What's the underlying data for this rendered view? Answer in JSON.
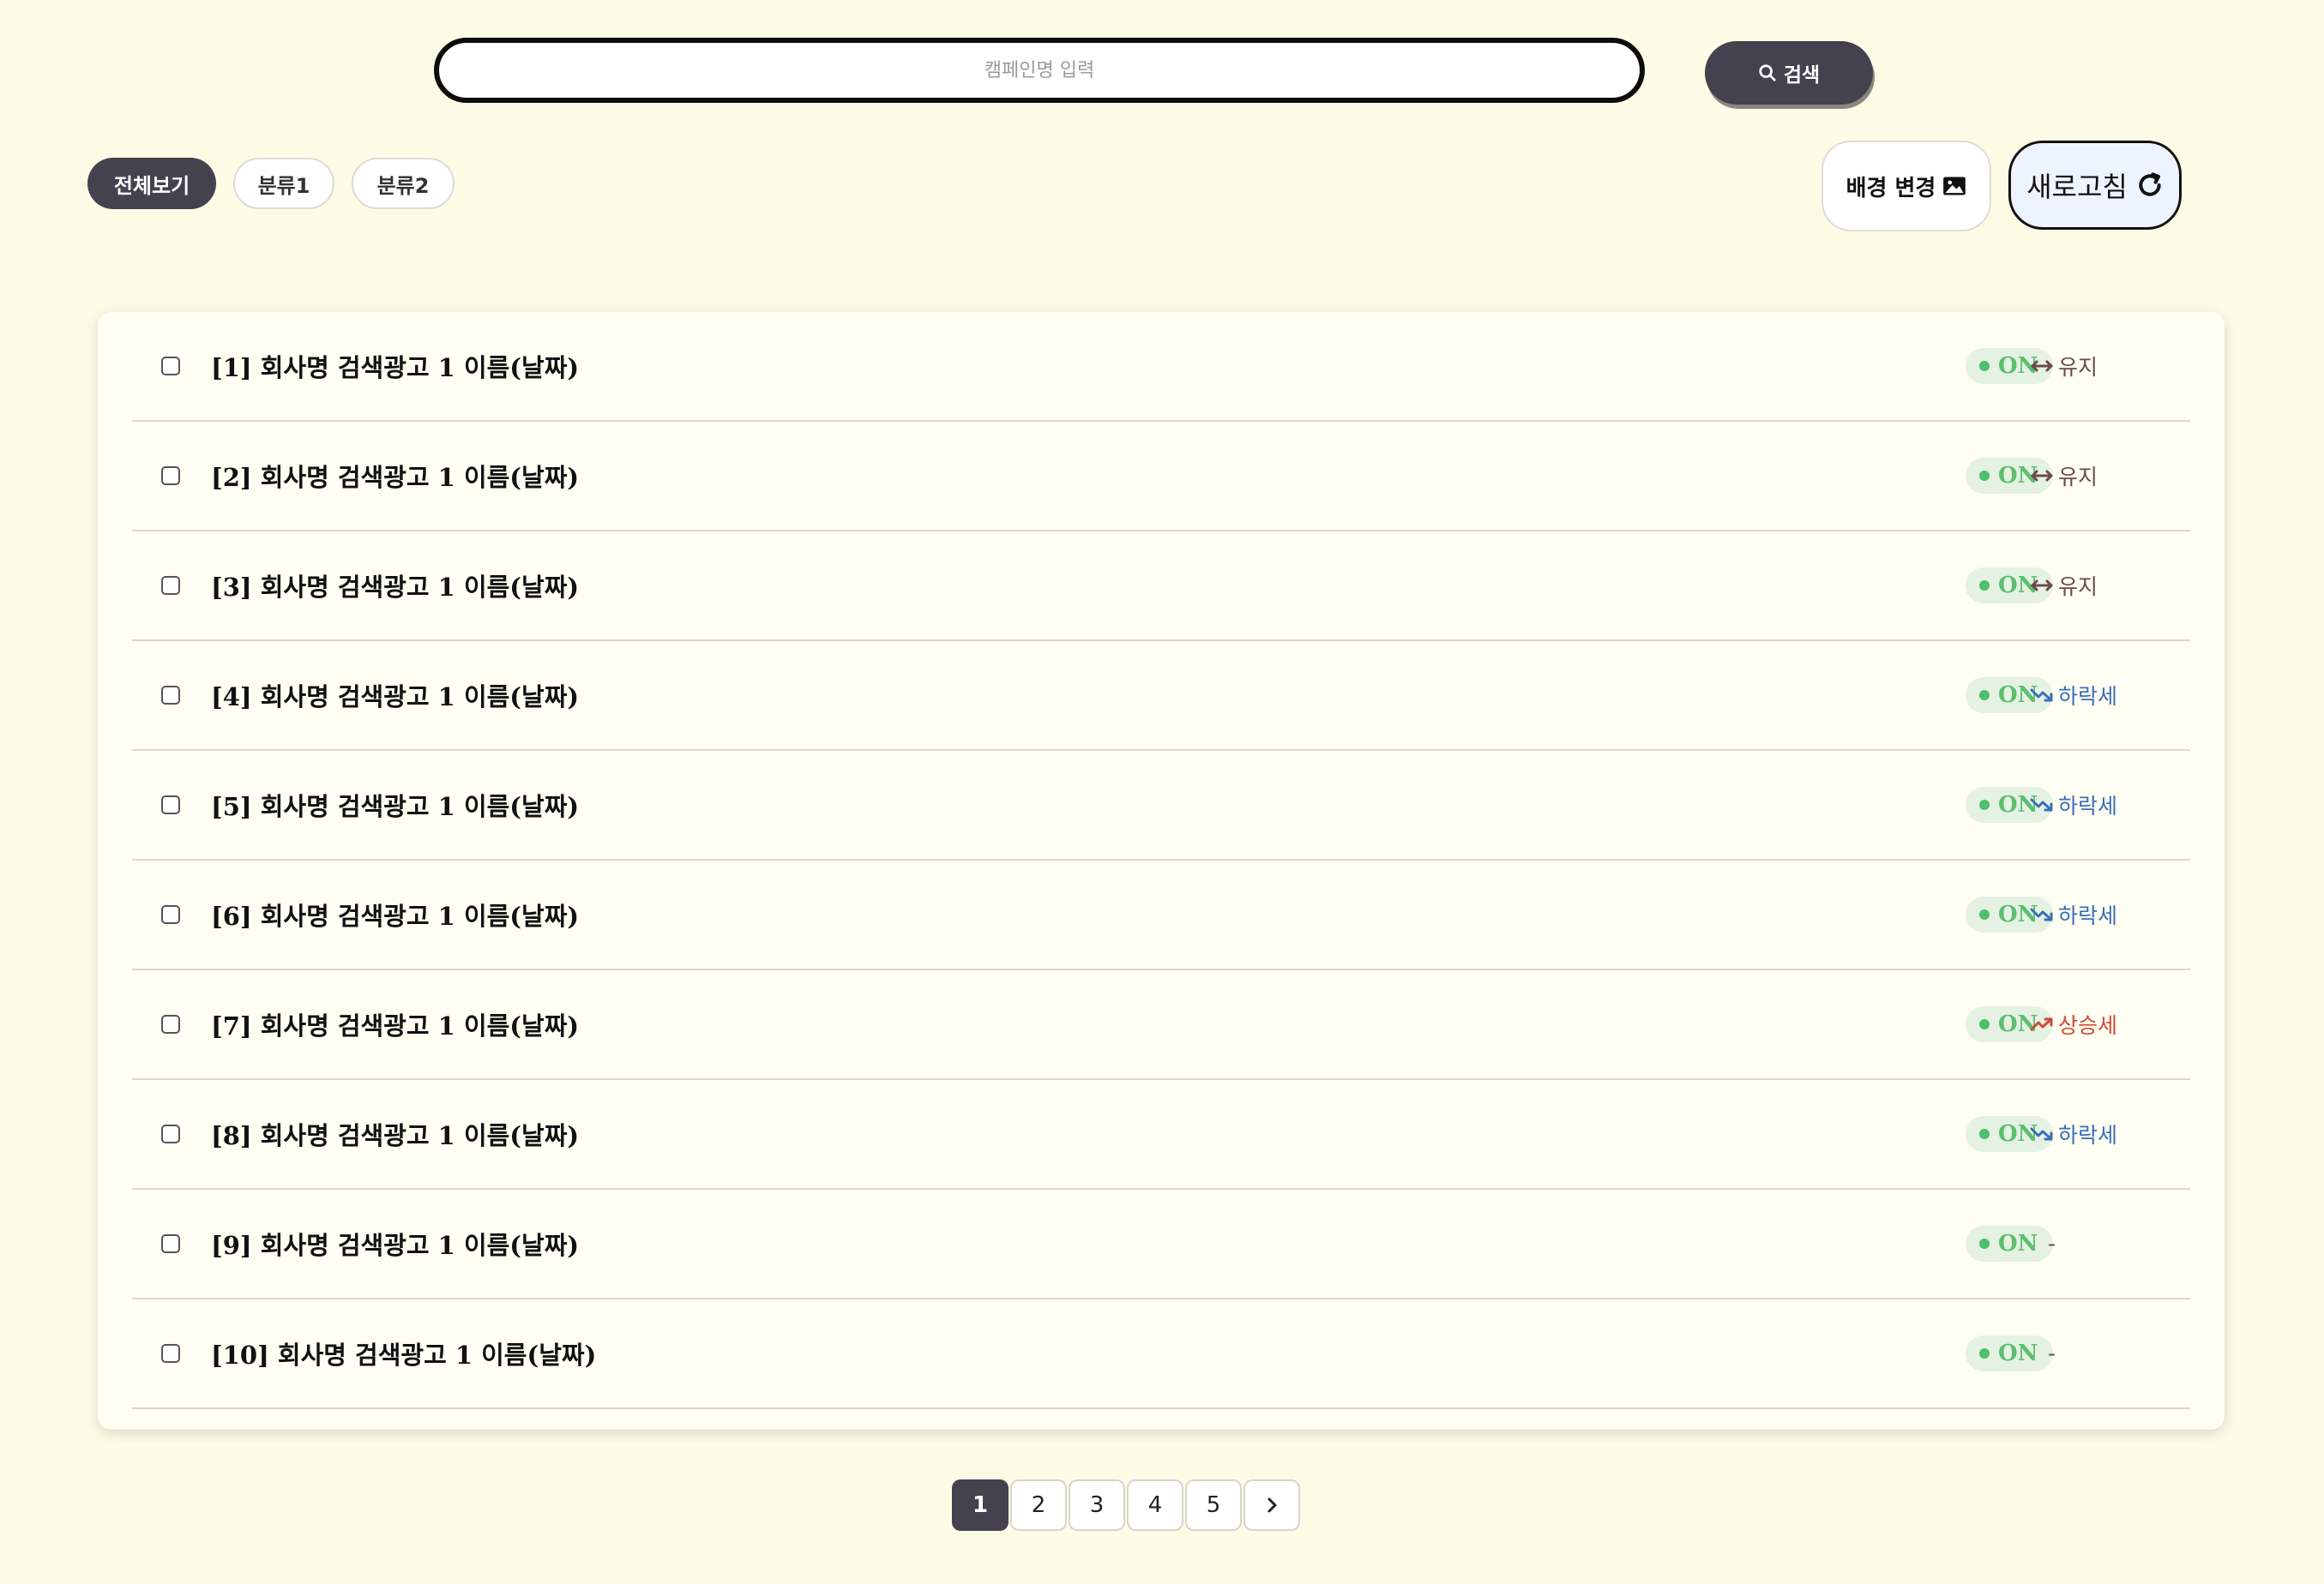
{
  "search": {
    "placeholder": "캠페인명 입력",
    "value": "",
    "button_label": "검색",
    "button_icon": "search-icon"
  },
  "filters": [
    {
      "label": "전체보기",
      "active": true
    },
    {
      "label": "분류1",
      "active": false
    },
    {
      "label": "분류2",
      "active": false
    }
  ],
  "actions": {
    "change_background_label": "배경 변경",
    "change_background_icon": "image-icon",
    "refresh_label": "새로고침",
    "refresh_icon": "refresh-icon"
  },
  "campaigns": [
    {
      "title": "[1] 회사명 검색광고 1 이름(날짜)",
      "status": "ON",
      "trend": "유지",
      "trend_type": "hold"
    },
    {
      "title": "[2] 회사명 검색광고 1 이름(날짜)",
      "status": "ON",
      "trend": "유지",
      "trend_type": "hold"
    },
    {
      "title": "[3] 회사명 검색광고 1 이름(날짜)",
      "status": "ON",
      "trend": "유지",
      "trend_type": "hold"
    },
    {
      "title": "[4] 회사명 검색광고 1 이름(날짜)",
      "status": "ON",
      "trend": "하락세",
      "trend_type": "down"
    },
    {
      "title": "[5] 회사명 검색광고 1 이름(날짜)",
      "status": "ON",
      "trend": "하락세",
      "trend_type": "down"
    },
    {
      "title": "[6] 회사명 검색광고 1 이름(날짜)",
      "status": "ON",
      "trend": "하락세",
      "trend_type": "down"
    },
    {
      "title": "[7] 회사명 검색광고 1 이름(날짜)",
      "status": "ON",
      "trend": "상승세",
      "trend_type": "up"
    },
    {
      "title": "[8] 회사명 검색광고 1 이름(날짜)",
      "status": "ON",
      "trend": "하락세",
      "trend_type": "down"
    },
    {
      "title": "[9] 회사명 검색광고 1 이름(날짜)",
      "status": "ON",
      "trend": "-",
      "trend_type": "none"
    },
    {
      "title": "[10] 회사명 검색광고 1 이름(날짜)",
      "status": "ON",
      "trend": "-",
      "trend_type": "none"
    }
  ],
  "pagination": {
    "pages": [
      "1",
      "2",
      "3",
      "4",
      "5"
    ],
    "current": "1",
    "next_icon": "chevron-right-icon"
  },
  "colors": {
    "background": "#fcfce6",
    "dark": "#45424f",
    "status_on": "#5cbf70",
    "trend_hold": "#6b4a4a",
    "trend_down": "#3a6fb7",
    "trend_up": "#d04a36"
  }
}
